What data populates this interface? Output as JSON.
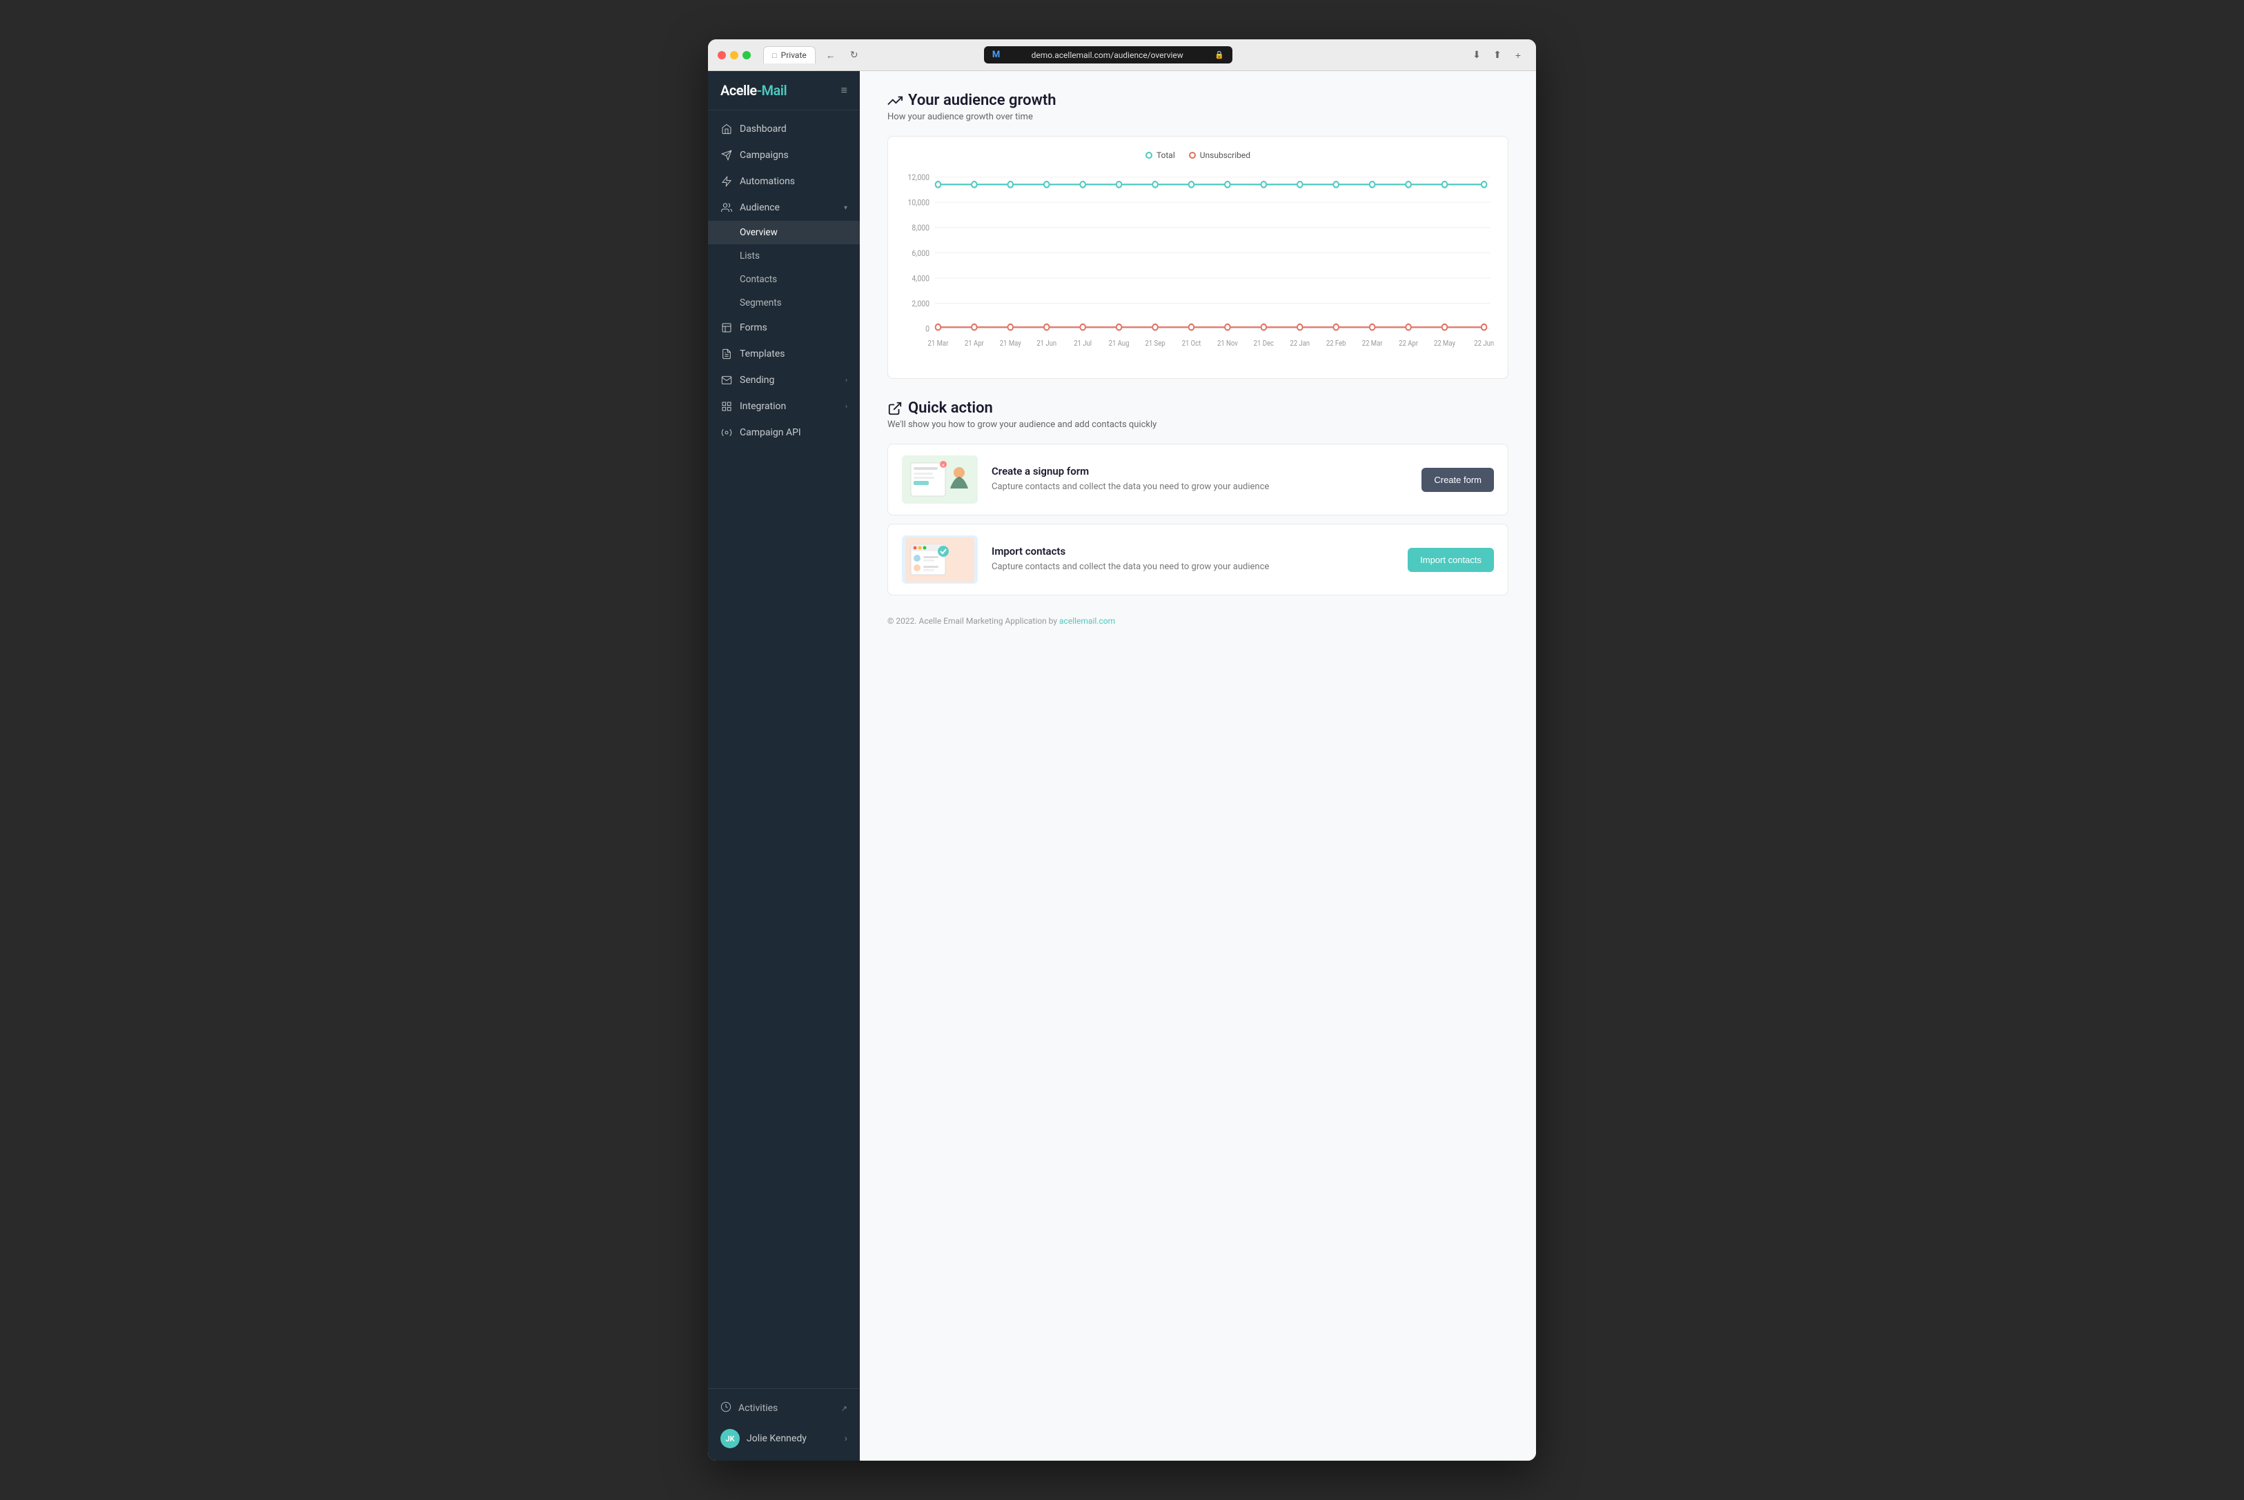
{
  "browser": {
    "tab_label": "Private",
    "url": "demo.acellemail.com/audience/overview",
    "back_btn": "←",
    "refresh_btn": "↻",
    "download_icon": "⬇",
    "share_icon": "⬆",
    "add_icon": "+"
  },
  "logo": {
    "text_part1": "Acelle",
    "text_part2": "Mail"
  },
  "sidebar": {
    "toggle_icon": "≡",
    "items": [
      {
        "id": "dashboard",
        "label": "Dashboard",
        "icon": "home"
      },
      {
        "id": "campaigns",
        "label": "Campaigns",
        "icon": "send"
      },
      {
        "id": "automations",
        "label": "Automations",
        "icon": "zap"
      },
      {
        "id": "audience",
        "label": "Audience",
        "icon": "users",
        "expanded": true,
        "chevron": "▾"
      },
      {
        "id": "overview",
        "label": "Overview",
        "sub": true,
        "active": true
      },
      {
        "id": "lists",
        "label": "Lists",
        "sub": true
      },
      {
        "id": "contacts",
        "label": "Contacts",
        "sub": true
      },
      {
        "id": "segments",
        "label": "Segments",
        "sub": true
      },
      {
        "id": "forms",
        "label": "Forms",
        "icon": "layout"
      },
      {
        "id": "templates",
        "label": "Templates",
        "icon": "file-text"
      },
      {
        "id": "sending",
        "label": "Sending",
        "icon": "mail",
        "chevron": "›"
      },
      {
        "id": "integration",
        "label": "Integration",
        "icon": "grid",
        "chevron": "›"
      },
      {
        "id": "campaign-api",
        "label": "Campaign API",
        "icon": "settings"
      }
    ],
    "footer": {
      "activities_label": "Activities",
      "activities_icon": "clock",
      "external_icon": "↗",
      "user_name": "Jolie Kennedy",
      "user_initials": "JK",
      "user_chevron": "›"
    }
  },
  "main": {
    "chart_section": {
      "title": "Your audience growth",
      "title_icon": "trending-up",
      "subtitle": "How your audience growth over time",
      "legend": {
        "total_label": "Total",
        "unsub_label": "Unsubscribed"
      },
      "y_labels": [
        "12,000",
        "10,000",
        "8,000",
        "6,000",
        "4,000",
        "2,000",
        "0"
      ],
      "x_labels": [
        "21 Mar",
        "21 Apr",
        "21 May",
        "21 Jun",
        "21 Jul",
        "21 Aug",
        "21 Sep",
        "21 Oct",
        "21 Nov",
        "21 Dec",
        "22 Jan",
        "22 Feb",
        "22 Mar",
        "22 Apr",
        "22 May",
        "22 Jun"
      ],
      "total_value": 11000,
      "unsub_value": 0
    },
    "quick_action": {
      "title": "Quick action",
      "title_icon": "external-link",
      "subtitle": "We'll show you how to grow your audience and add contacts quickly",
      "cards": [
        {
          "id": "create-form",
          "title": "Create a signup form",
          "description": "Capture contacts and collect the data you need to grow your audience",
          "btn_label": "Create form",
          "thumb_type": "form"
        },
        {
          "id": "import-contacts",
          "title": "Import contacts",
          "description": "Capture contacts and collect the data you need to grow your audience",
          "btn_label": "Import contacts",
          "thumb_type": "import"
        }
      ]
    },
    "footer": {
      "text": "© 2022. Acelle Email Marketing Application by",
      "link_text": "acellemail.com",
      "link_url": "https://acellemail.com"
    }
  }
}
